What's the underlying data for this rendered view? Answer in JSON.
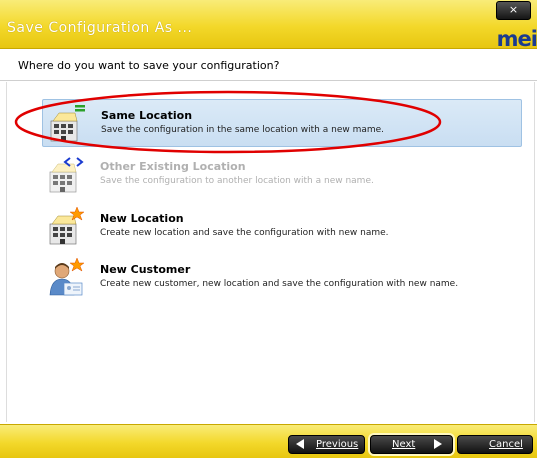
{
  "window": {
    "title": "Save Configuration As ...",
    "close_label": "×",
    "logo": "mei"
  },
  "header": {
    "question": "Where do you want to save your configuration?"
  },
  "options": [
    {
      "title": "Same Location",
      "description": "Save the configuration in the same location with a new mame.",
      "state": "selected"
    },
    {
      "title": "Other Existing Location",
      "description": "Save the configuration to another location with a new name.",
      "state": "disabled"
    },
    {
      "title": "New Location",
      "description": "Create new location and save the configuration with new name.",
      "state": "enabled"
    },
    {
      "title": "New Customer",
      "description": "Create new customer, new location and save the configuration with new name.",
      "state": "enabled"
    }
  ],
  "footer": {
    "previous_label": "Previous",
    "next_label": "Next",
    "cancel_label": "Cancel"
  },
  "colors": {
    "title_bar": "#f3d82a",
    "highlight": "#c9def2",
    "annotation": "#e00000"
  }
}
